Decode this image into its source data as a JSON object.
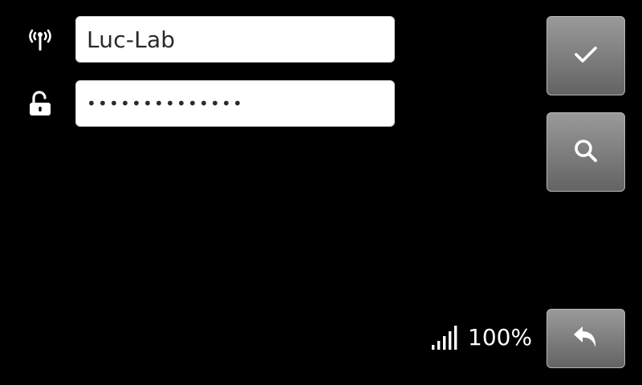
{
  "network": {
    "ssid_icon": "wifi-antenna-icon",
    "ssid_value": "Luc-Lab",
    "password_icon": "unlocked-padlock-icon",
    "password_value": "••••••••••••••"
  },
  "actions": {
    "confirm_icon": "checkmark-icon",
    "scan_icon": "search-icon",
    "back_icon": "back-arrow-icon"
  },
  "status": {
    "signal_icon": "signal-strength-icon",
    "signal_strength": "100%"
  },
  "colors": {
    "background": "#000000",
    "field_background": "#ffffff",
    "button_gradient_top": "#9a9a9a",
    "button_gradient_bottom": "#636363",
    "icon_color": "#ffffff"
  }
}
